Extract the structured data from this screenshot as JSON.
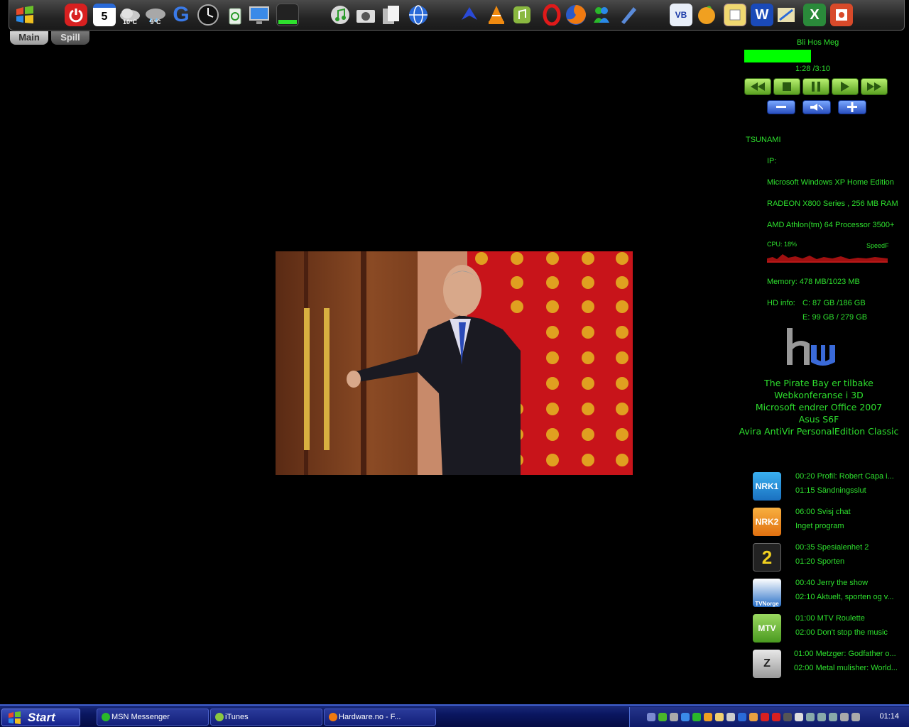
{
  "dock": {
    "tabs": {
      "main": "Main",
      "spill": "Spill"
    },
    "calendar_day": "5",
    "weather1_temp": "10°C",
    "weather2_temp": "9°C",
    "icons": [
      "windows-icon",
      "power-icon",
      "calendar-icon",
      "weather-cloud-icon",
      "weather-rain-icon",
      "google-icon",
      "clock-icon",
      "recycle-bin-icon",
      "monitor-icon",
      "task-monitor-icon",
      "itunes-icon",
      "camera-icon",
      "documents-icon",
      "network-globe-icon",
      "bird-icon",
      "vlc-icon",
      "winamp-icon",
      "opera-icon",
      "firefox-icon",
      "msn-icon",
      "pen-tools-icon",
      "vb-icon",
      "fruityloops-icon",
      "notes-icon",
      "word-icon",
      "map-icon",
      "excel-icon",
      "powerpoint-icon"
    ]
  },
  "media": {
    "track": "Bli Hos Meg",
    "time": "1:28 /3:10",
    "progress": 0.46
  },
  "system": {
    "hostname": "TSUNAMI",
    "ip_label": "IP:",
    "os": "Microsoft Windows XP Home Edition",
    "gpu": "RADEON X800 Series  , 256 MB RAM",
    "cpu_name": "AMD Athlon(tm) 64 Processor 3500+",
    "cpu_usage": "CPU: 18%",
    "speed_label": "SpeedF",
    "memory": "Memory: 478 MB/1023 MB",
    "hd_label": "HD info:",
    "hd_c": "C: 87 GB /186 GB",
    "hd_e": "E: 99 GB /   279 GB"
  },
  "news": [
    "The Pirate Bay er tilbake",
    "Webkonferanse i 3D",
    "Microsoft endrer Office 2007",
    "Asus S6F",
    "Avira AntiVir PersonalEdition Classic"
  ],
  "tv": [
    {
      "channel": "NRK1",
      "now": "00:20 Profil: Robert Capa i...",
      "next": "01:15 Sändningsslut",
      "color": "#1a8fd8"
    },
    {
      "channel": "NRK2",
      "now": "06:00 Svisj chat",
      "next": "Inget program",
      "color": "#f08a20"
    },
    {
      "channel": "2",
      "now": "00:35 Spesialenhet 2",
      "next": "01:20 Sporten",
      "color": "#2a2a2a"
    },
    {
      "channel": "TVNorge",
      "now": "00:40 Jerry the show",
      "next": "02:10 Aktuelt, sporten og v...",
      "color": "#2a70c8"
    },
    {
      "channel": "MTV",
      "now": "01:00 MTV Roulette",
      "next": "02:00 Don't stop the music",
      "color": "#58b82a"
    },
    {
      "channel": "Z",
      "now": "01:00 Metzger: Godfather o...",
      "next": "02:00 Metal mulisher: World...",
      "color": "#c0c0c0"
    }
  ],
  "taskbar": {
    "start": "Start",
    "tasks": [
      "MSN Messenger",
      "iTunes",
      "Hardware.no - F..."
    ],
    "clock": "01:14"
  }
}
